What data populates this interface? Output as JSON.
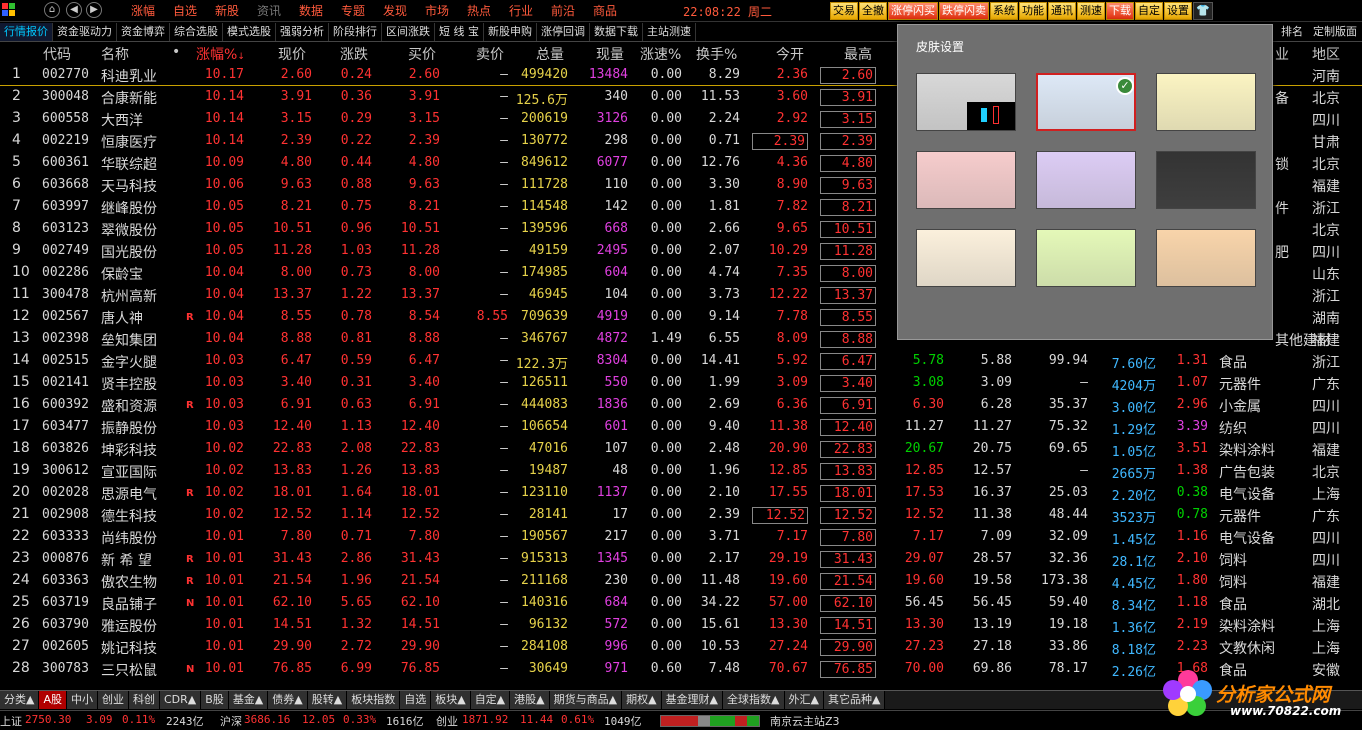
{
  "menubar": {
    "items": [
      "涨幅",
      "自选",
      "新股",
      "资讯",
      "数据",
      "专题",
      "发现",
      "市场",
      "热点",
      "行业",
      "前沿",
      "商品"
    ],
    "clock": "22:08:22 周二",
    "right_buttons": [
      "交易",
      "全撤",
      "涨停闪买",
      "跌停闪卖",
      "系统",
      "功能",
      "通讯",
      "测速",
      "下载",
      "自定",
      "设置"
    ]
  },
  "subtabs": {
    "left": [
      "行情报价",
      "资金驱动力",
      "资金博弈",
      "综合选股",
      "模式选股",
      "强弱分析",
      "阶段排行",
      "区间涨跌",
      "短 线 宝",
      "新股申购",
      "涨停回调",
      "数据下载",
      "主站测速"
    ],
    "right": [
      "排名",
      "定制版面"
    ]
  },
  "table": {
    "headers": {
      "code": "代码",
      "name": "名称",
      "dot": "•",
      "pct": "涨幅%",
      "price": "现价",
      "change": "涨跌",
      "buy": "买价",
      "sell": "卖价",
      "volume": "总量",
      "cur_vol": "现量",
      "speed": "涨速%",
      "turnover": "换手%",
      "open": "今开",
      "high": "最高",
      "industry": "业",
      "region": "地区"
    },
    "rows": [
      {
        "idx": "1",
        "code": "002770",
        "name": "科迪乳业",
        "mark": "",
        "pct": "10.17",
        "price": "2.60",
        "chg": "0.24",
        "buy": "2.60",
        "sell": "–",
        "vol": "499420",
        "cur": "13484",
        "spd": "0.00",
        "turn": "8.29",
        "open": "2.36",
        "high": "2.60",
        "l": "",
        "pe": "",
        "amt": "",
        "vr": "",
        "ind": "",
        "reg": "河南"
      },
      {
        "idx": "2",
        "code": "300048",
        "name": "合康新能",
        "mark": "",
        "pct": "10.14",
        "price": "3.91",
        "chg": "0.36",
        "buy": "3.91",
        "sell": "–",
        "vol": "125.6万",
        "cur": "340",
        "spd": "0.00",
        "turn": "11.53",
        "open": "3.60",
        "high": "3.91",
        "l": "",
        "pe": "",
        "amt": "",
        "vr": "",
        "ind": "备",
        "reg": "北京"
      },
      {
        "idx": "3",
        "code": "600558",
        "name": "大西洋",
        "mark": "",
        "pct": "10.14",
        "price": "3.15",
        "chg": "0.29",
        "buy": "3.15",
        "sell": "–",
        "vol": "200619",
        "cur": "3126",
        "spd": "0.00",
        "turn": "2.24",
        "open": "2.92",
        "high": "3.15",
        "l": "",
        "pe": "",
        "amt": "",
        "vr": "",
        "ind": "",
        "reg": "四川"
      },
      {
        "idx": "4",
        "code": "002219",
        "name": "恒康医疗",
        "mark": "",
        "pct": "10.14",
        "price": "2.39",
        "chg": "0.22",
        "buy": "2.39",
        "sell": "–",
        "vol": "130772",
        "cur": "298",
        "spd": "0.00",
        "turn": "0.71",
        "open": "2.39",
        "high": "2.39",
        "l": "",
        "pe": "",
        "amt": "",
        "vr": "",
        "ind": "",
        "reg": "甘肃"
      },
      {
        "idx": "5",
        "code": "600361",
        "name": "华联综超",
        "mark": "",
        "pct": "10.09",
        "price": "4.80",
        "chg": "0.44",
        "buy": "4.80",
        "sell": "–",
        "vol": "849612",
        "cur": "6077",
        "spd": "0.00",
        "turn": "12.76",
        "open": "4.36",
        "high": "4.80",
        "l": "",
        "pe": "",
        "amt": "",
        "vr": "",
        "ind": "锁",
        "reg": "北京"
      },
      {
        "idx": "6",
        "code": "603668",
        "name": "天马科技",
        "mark": "",
        "pct": "10.06",
        "price": "9.63",
        "chg": "0.88",
        "buy": "9.63",
        "sell": "–",
        "vol": "111728",
        "cur": "110",
        "spd": "0.00",
        "turn": "3.30",
        "open": "8.90",
        "high": "9.63",
        "l": "",
        "pe": "",
        "amt": "",
        "vr": "",
        "ind": "",
        "reg": "福建"
      },
      {
        "idx": "7",
        "code": "603997",
        "name": "继峰股份",
        "mark": "",
        "pct": "10.05",
        "price": "8.21",
        "chg": "0.75",
        "buy": "8.21",
        "sell": "–",
        "vol": "114548",
        "cur": "142",
        "spd": "0.00",
        "turn": "1.81",
        "open": "7.82",
        "high": "8.21",
        "l": "",
        "pe": "",
        "amt": "",
        "vr": "",
        "ind": "件",
        "reg": "浙江"
      },
      {
        "idx": "8",
        "code": "603123",
        "name": "翠微股份",
        "mark": "",
        "pct": "10.05",
        "price": "10.51",
        "chg": "0.96",
        "buy": "10.51",
        "sell": "–",
        "vol": "139596",
        "cur": "668",
        "spd": "0.00",
        "turn": "2.66",
        "open": "9.65",
        "high": "10.51",
        "l": "",
        "pe": "",
        "amt": "",
        "vr": "",
        "ind": "",
        "reg": "北京"
      },
      {
        "idx": "9",
        "code": "002749",
        "name": "国光股份",
        "mark": "",
        "pct": "10.05",
        "price": "11.28",
        "chg": "1.03",
        "buy": "11.28",
        "sell": "–",
        "vol": "49159",
        "cur": "2495",
        "spd": "0.00",
        "turn": "2.07",
        "open": "10.29",
        "high": "11.28",
        "l": "",
        "pe": "",
        "amt": "",
        "vr": "",
        "ind": "肥",
        "reg": "四川"
      },
      {
        "idx": "10",
        "code": "002286",
        "name": "保龄宝",
        "mark": "",
        "pct": "10.04",
        "price": "8.00",
        "chg": "0.73",
        "buy": "8.00",
        "sell": "–",
        "vol": "174985",
        "cur": "604",
        "spd": "0.00",
        "turn": "4.74",
        "open": "7.35",
        "high": "8.00",
        "l": "",
        "pe": "",
        "amt": "",
        "vr": "",
        "ind": "",
        "reg": "山东"
      },
      {
        "idx": "11",
        "code": "300478",
        "name": "杭州高新",
        "mark": "",
        "pct": "10.04",
        "price": "13.37",
        "chg": "1.22",
        "buy": "13.37",
        "sell": "–",
        "vol": "46945",
        "cur": "104",
        "spd": "0.00",
        "turn": "3.73",
        "open": "12.22",
        "high": "13.37",
        "l": "",
        "pe": "",
        "amt": "",
        "vr": "",
        "ind": "",
        "reg": "浙江"
      },
      {
        "idx": "12",
        "code": "002567",
        "name": "唐人神",
        "mark": "R",
        "pct": "10.04",
        "price": "8.55",
        "chg": "0.78",
        "buy": "8.54",
        "sell": "8.55",
        "vol": "709639",
        "cur": "4919",
        "spd": "0.00",
        "turn": "9.14",
        "open": "7.78",
        "high": "8.55",
        "l": "",
        "pe": "",
        "amt": "",
        "vr": "",
        "ind": "",
        "reg": "湖南"
      },
      {
        "idx": "13",
        "code": "002398",
        "name": "垒知集团",
        "mark": "",
        "pct": "10.04",
        "price": "8.88",
        "chg": "0.81",
        "buy": "8.88",
        "sell": "–",
        "vol": "346767",
        "cur": "4872",
        "spd": "1.49",
        "turn": "6.55",
        "open": "8.09",
        "high": "8.88",
        "l": "",
        "pe": "",
        "amt": "",
        "vr": "",
        "ind": "其他建材",
        "reg": "福建"
      },
      {
        "idx": "14",
        "code": "002515",
        "name": "金字火腿",
        "mark": "",
        "pct": "10.03",
        "price": "6.47",
        "chg": "0.59",
        "buy": "6.47",
        "sell": "–",
        "vol": "122.3万",
        "cur": "8304",
        "spd": "0.00",
        "turn": "14.41",
        "open": "5.92",
        "high": "6.47",
        "l": "5.78",
        "pe": "5.88",
        "amt": "99.94",
        "vr": "7.60亿",
        "x": "1.31",
        "ind": "食品",
        "reg": "浙江"
      },
      {
        "idx": "15",
        "code": "002141",
        "name": "贤丰控股",
        "mark": "",
        "pct": "10.03",
        "price": "3.40",
        "chg": "0.31",
        "buy": "3.40",
        "sell": "–",
        "vol": "126511",
        "cur": "550",
        "spd": "0.00",
        "turn": "1.99",
        "open": "3.09",
        "high": "3.40",
        "l": "3.08",
        "pe": "3.09",
        "amt": "–",
        "vr": "4204万",
        "x": "1.07",
        "ind": "元器件",
        "reg": "广东"
      },
      {
        "idx": "16",
        "code": "600392",
        "name": "盛和资源",
        "mark": "R",
        "pct": "10.03",
        "price": "6.91",
        "chg": "0.63",
        "buy": "6.91",
        "sell": "–",
        "vol": "444083",
        "cur": "1836",
        "spd": "0.00",
        "turn": "2.69",
        "open": "6.36",
        "high": "6.91",
        "l": "6.30",
        "pe": "6.28",
        "amt": "35.37",
        "vr": "3.00亿",
        "x": "2.96",
        "ind": "小金属",
        "reg": "四川"
      },
      {
        "idx": "17",
        "code": "603477",
        "name": "振静股份",
        "mark": "",
        "pct": "10.03",
        "price": "12.40",
        "chg": "1.13",
        "buy": "12.40",
        "sell": "–",
        "vol": "106654",
        "cur": "601",
        "spd": "0.00",
        "turn": "9.40",
        "open": "11.38",
        "high": "12.40",
        "l": "11.27",
        "pe": "11.27",
        "amt": "75.32",
        "vr": "1.29亿",
        "x": "3.39",
        "ind": "纺织",
        "reg": "四川"
      },
      {
        "idx": "18",
        "code": "603826",
        "name": "坤彩科技",
        "mark": "",
        "pct": "10.02",
        "price": "22.83",
        "chg": "2.08",
        "buy": "22.83",
        "sell": "–",
        "vol": "47016",
        "cur": "107",
        "spd": "0.00",
        "turn": "2.48",
        "open": "20.90",
        "high": "22.83",
        "l": "20.67",
        "pe": "20.75",
        "amt": "69.65",
        "vr": "1.05亿",
        "x": "3.51",
        "ind": "染料涂料",
        "reg": "福建"
      },
      {
        "idx": "19",
        "code": "300612",
        "name": "宣亚国际",
        "mark": "",
        "pct": "10.02",
        "price": "13.83",
        "chg": "1.26",
        "buy": "13.83",
        "sell": "–",
        "vol": "19487",
        "cur": "48",
        "spd": "0.00",
        "turn": "1.96",
        "open": "12.85",
        "high": "13.83",
        "l": "12.85",
        "pe": "12.57",
        "amt": "–",
        "vr": "2665万",
        "x": "1.38",
        "ind": "广告包装",
        "reg": "北京"
      },
      {
        "idx": "20",
        "code": "002028",
        "name": "思源电气",
        "mark": "R",
        "pct": "10.02",
        "price": "18.01",
        "chg": "1.64",
        "buy": "18.01",
        "sell": "–",
        "vol": "123110",
        "cur": "1137",
        "spd": "0.00",
        "turn": "2.10",
        "open": "17.55",
        "high": "18.01",
        "l": "17.53",
        "pe": "16.37",
        "amt": "25.03",
        "vr": "2.20亿",
        "x": "0.38",
        "ind": "电气设备",
        "reg": "上海"
      },
      {
        "idx": "21",
        "code": "002908",
        "name": "德生科技",
        "mark": "",
        "pct": "10.02",
        "price": "12.52",
        "chg": "1.14",
        "buy": "12.52",
        "sell": "–",
        "vol": "28141",
        "cur": "17",
        "spd": "0.00",
        "turn": "2.39",
        "open": "12.52",
        "high": "12.52",
        "l": "12.52",
        "pe": "11.38",
        "amt": "48.44",
        "vr": "3523万",
        "x": "0.78",
        "ind": "元器件",
        "reg": "广东"
      },
      {
        "idx": "22",
        "code": "603333",
        "name": "尚纬股份",
        "mark": "",
        "pct": "10.01",
        "price": "7.80",
        "chg": "0.71",
        "buy": "7.80",
        "sell": "–",
        "vol": "190567",
        "cur": "217",
        "spd": "0.00",
        "turn": "3.71",
        "open": "7.17",
        "high": "7.80",
        "l": "7.17",
        "pe": "7.09",
        "amt": "32.09",
        "vr": "1.45亿",
        "x": "1.16",
        "ind": "电气设备",
        "reg": "四川"
      },
      {
        "idx": "23",
        "code": "000876",
        "name": "新 希 望",
        "mark": "R",
        "pct": "10.01",
        "price": "31.43",
        "chg": "2.86",
        "buy": "31.43",
        "sell": "–",
        "vol": "915313",
        "cur": "1345",
        "spd": "0.00",
        "turn": "2.17",
        "open": "29.19",
        "high": "31.43",
        "l": "29.07",
        "pe": "28.57",
        "amt": "32.36",
        "vr": "28.1亿",
        "x": "2.10",
        "ind": "饲料",
        "reg": "四川"
      },
      {
        "idx": "24",
        "code": "603363",
        "name": "傲农生物",
        "mark": "R",
        "pct": "10.01",
        "price": "21.54",
        "chg": "1.96",
        "buy": "21.54",
        "sell": "–",
        "vol": "211168",
        "cur": "230",
        "spd": "0.00",
        "turn": "11.48",
        "open": "19.60",
        "high": "21.54",
        "l": "19.60",
        "pe": "19.58",
        "amt": "173.38",
        "vr": "4.45亿",
        "x": "1.80",
        "ind": "饲料",
        "reg": "福建"
      },
      {
        "idx": "25",
        "code": "603719",
        "name": "良品铺子",
        "mark": "N",
        "pct": "10.01",
        "price": "62.10",
        "chg": "5.65",
        "buy": "62.10",
        "sell": "–",
        "vol": "140316",
        "cur": "684",
        "spd": "0.00",
        "turn": "34.22",
        "open": "57.00",
        "high": "62.10",
        "l": "56.45",
        "pe": "56.45",
        "amt": "59.40",
        "vr": "8.34亿",
        "x": "1.18",
        "ind": "食品",
        "reg": "湖北"
      },
      {
        "idx": "26",
        "code": "603790",
        "name": "雅运股份",
        "mark": "",
        "pct": "10.01",
        "price": "14.51",
        "chg": "1.32",
        "buy": "14.51",
        "sell": "–",
        "vol": "96132",
        "cur": "572",
        "spd": "0.00",
        "turn": "15.61",
        "open": "13.30",
        "high": "14.51",
        "l": "13.30",
        "pe": "13.19",
        "amt": "19.18",
        "vr": "1.36亿",
        "x": "2.19",
        "ind": "染料涂料",
        "reg": "上海"
      },
      {
        "idx": "27",
        "code": "002605",
        "name": "姚记科技",
        "mark": "",
        "pct": "10.01",
        "price": "29.90",
        "chg": "2.72",
        "buy": "29.90",
        "sell": "–",
        "vol": "284108",
        "cur": "996",
        "spd": "0.00",
        "turn": "10.53",
        "open": "27.24",
        "high": "29.90",
        "l": "27.23",
        "pe": "27.18",
        "amt": "33.86",
        "vr": "8.18亿",
        "x": "2.23",
        "ind": "文教休闲",
        "reg": "上海"
      },
      {
        "idx": "28",
        "code": "300783",
        "name": "三只松鼠",
        "mark": "N",
        "pct": "10.01",
        "price": "76.85",
        "chg": "6.99",
        "buy": "76.85",
        "sell": "–",
        "vol": "30649",
        "cur": "971",
        "spd": "0.60",
        "turn": "7.48",
        "open": "70.67",
        "high": "76.85",
        "l": "70.00",
        "pe": "69.86",
        "amt": "78.17",
        "vr": "2.26亿",
        "x": "1.68",
        "ind": "食品",
        "reg": "安徽"
      }
    ]
  },
  "bottom_tabs": [
    "分类▲",
    "A股",
    "中小",
    "创业",
    "科创",
    "CDR▲",
    "B股",
    "基金▲",
    "债券▲",
    "股转▲",
    "板块指数",
    "自选",
    "板块▲",
    "自定▲",
    "港股▲",
    "期货与商品▲",
    "期权▲",
    "基金理财▲",
    "全球指数▲",
    "外汇▲",
    "其它品种▲"
  ],
  "status": {
    "sh_label": "上证",
    "sh_val": "2750.30",
    "sh_chg": "3.09",
    "sh_pct": "0.11%",
    "sh_amt": "2243亿",
    "hs_label": "沪深",
    "hs_val": "3686.16",
    "hs_chg": "12.05",
    "hs_pct": "0.33%",
    "hs_amt": "1616亿",
    "cy_label": "创业",
    "cy_val": "1871.92",
    "cy_chg": "11.44",
    "cy_pct": "0.61%",
    "cy_amt": "1049亿",
    "server": "南京云主站Z3"
  },
  "skin_panel": {
    "title": "皮肤设置",
    "swatches": [
      "#d8d8d8",
      "#dde8f6",
      "#fbf4c2",
      "#f6cccc",
      "#dcccf4",
      "#333333",
      "#fbf0dc",
      "#e4f8b8",
      "#f8d4aa"
    ],
    "selected_index": 1
  },
  "watermark": {
    "text": "分析家公式网",
    "url": "www.70822.com"
  }
}
